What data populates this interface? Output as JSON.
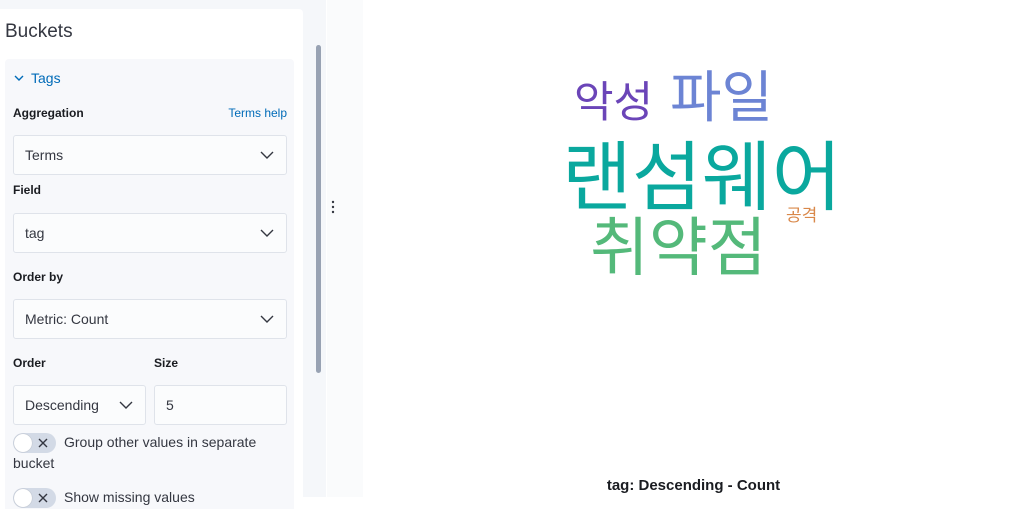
{
  "sidebar": {
    "title": "Buckets",
    "bucket": {
      "toggle_label": "Tags",
      "aggregation": {
        "label": "Aggregation",
        "help_link": "Terms help",
        "value": "Terms"
      },
      "field": {
        "label": "Field",
        "value": "tag"
      },
      "order_by": {
        "label": "Order by",
        "value": "Metric: Count"
      },
      "order": {
        "label": "Order",
        "value": "Descending"
      },
      "size": {
        "label": "Size",
        "value": "5"
      },
      "group_other": {
        "label": "Group other values in separate bucket",
        "enabled": false
      },
      "show_missing": {
        "label": "Show missing values",
        "enabled": false
      }
    }
  },
  "visualization": {
    "type": "tag-cloud",
    "words": [
      {
        "text": "랜섬웨어",
        "color": "#0aa89e"
      },
      {
        "text": "파일",
        "color": "#6c84d4"
      },
      {
        "text": "취약점",
        "color": "#54b97a"
      },
      {
        "text": "악성",
        "color": "#6b45b8"
      },
      {
        "text": "공격",
        "color": "#d9884a"
      }
    ],
    "caption": "tag: Descending - Count"
  }
}
